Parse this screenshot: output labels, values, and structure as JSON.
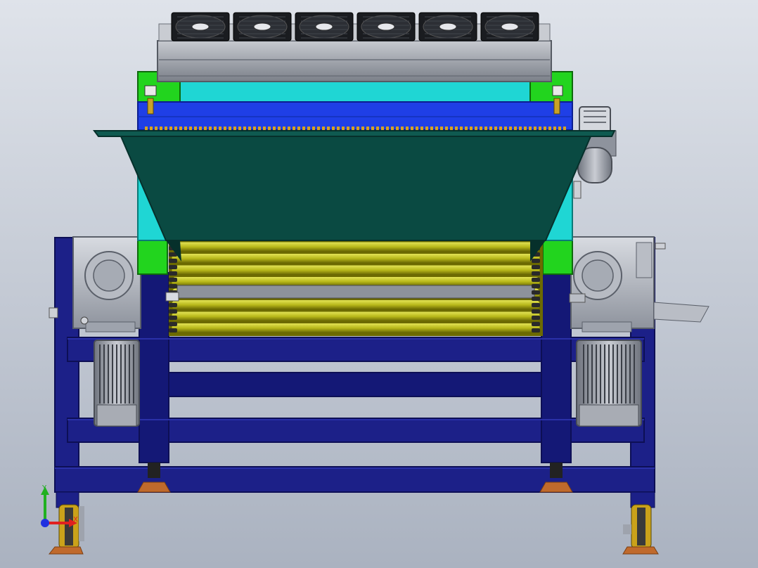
{
  "viewport": {
    "background_top": "#dfe3ea",
    "background_bottom": "#aab2c0"
  },
  "colors": {
    "frame_navy": "#1c2088",
    "frame_navy_dark": "#0d0f55",
    "frame_navy_light": "#2a30a8",
    "beam_blue": "#1f3fe6",
    "bracket_green": "#22d41e",
    "hopper_dark_green": "#0a4a42",
    "hopper_edge": "#06302b",
    "hopper_cyan": "#1fd6d4",
    "roller_yellow": "#b8b81a",
    "roller_yellow_dark": "#6c6a00",
    "metal_grey": "#9ea3ad",
    "metal_light": "#cdd0d6",
    "foot_orange": "#c06a2c",
    "fan_black": "#1a1c20",
    "axis_x": "#e02020",
    "axis_y": "#20b020",
    "axis_z": "#2030e0"
  },
  "icons": {
    "fan": "cooling-fan-icon",
    "motor": "electric-motor-icon",
    "gearbox": "gearbox-icon",
    "caster": "caster-wheel-icon",
    "triad": "coordinate-axes-icon"
  },
  "triad": {
    "y_label": "Y",
    "x_label": "X"
  },
  "fans": {
    "count": 6
  },
  "rollers": {
    "count": 8
  }
}
